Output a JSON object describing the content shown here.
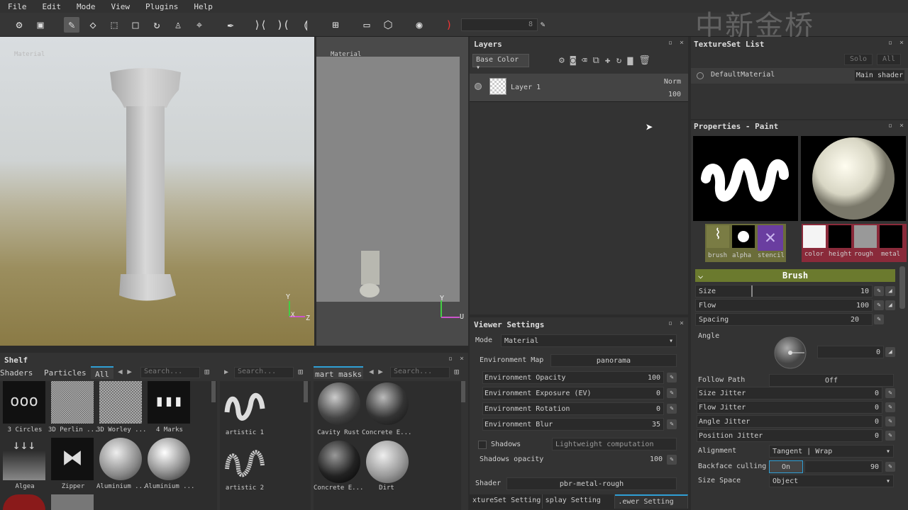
{
  "menu": [
    "File",
    "Edit",
    "Mode",
    "View",
    "Plugins",
    "Help"
  ],
  "toolbar": {
    "field_value": "8"
  },
  "watermark": "中新金桥",
  "viewport3d": {
    "label": "Material",
    "axis_y": "Y",
    "axis_x": "X",
    "axis_z": "Z"
  },
  "viewport2d": {
    "label": "Material",
    "axis_y": "Y",
    "axis_u": "U"
  },
  "layers": {
    "title": "Layers",
    "channel": "Base Color",
    "layer_name": "Layer 1",
    "blend": "Norm",
    "opacity": "100"
  },
  "viewer": {
    "title": "Viewer Settings",
    "mode_label": "Mode",
    "mode_value": "Material",
    "env_map_label": "Environment Map",
    "env_map_value": "panorama",
    "rows": [
      {
        "label": "Environment Opacity",
        "value": "100"
      },
      {
        "label": "Environment Exposure (EV)",
        "value": "0"
      },
      {
        "label": "Environment Rotation",
        "value": "0"
      },
      {
        "label": "Environment Blur",
        "value": "35"
      }
    ],
    "shadows_label": "Shadows",
    "shadows_value": "Lightweight computation",
    "shadows_opacity_label": "Shadows opacity",
    "shadows_opacity_value": "100",
    "shader_label": "Shader",
    "shader_value": "pbr-metal-rough"
  },
  "bottom_tabs": [
    "xtureSet Setting",
    "splay Setting",
    ".ewer Setting"
  ],
  "tsl": {
    "title": "TextureSet List",
    "solo": "Solo",
    "all": "All",
    "material": "DefaultMaterial",
    "shader": "Main shader"
  },
  "props": {
    "title": "Properties - Paint",
    "slots": [
      "brush",
      "alpha",
      "stencil"
    ],
    "maps": [
      "color",
      "height",
      "rough",
      "metal"
    ],
    "section": "Brush",
    "size_label": "Size",
    "size_value": "10",
    "flow_label": "Flow",
    "flow_value": "100",
    "spacing_label": "Spacing",
    "spacing_value": "20",
    "angle_label": "Angle",
    "angle_value": "0",
    "follow_label": "Follow Path",
    "follow_value": "Off",
    "jitters": [
      {
        "label": "Size Jitter",
        "value": "0"
      },
      {
        "label": "Flow Jitter",
        "value": "0"
      },
      {
        "label": "Angle Jitter",
        "value": "0"
      },
      {
        "label": "Position Jitter",
        "value": "0"
      }
    ],
    "alignment_label": "Alignment",
    "alignment_value": "Tangent | Wrap",
    "backface_label": "Backface culling",
    "backface_on": "On",
    "backface_value": "90",
    "sizespace_label": "Size Space",
    "sizespace_value": "Object"
  },
  "shelf": {
    "title": "Shelf",
    "tabs": [
      "Shaders",
      "Particles",
      "All"
    ],
    "search": "Search...",
    "search2": "Search...",
    "mid_tab": "mart masks",
    "search3": "Search...",
    "items": [
      "3 Circles",
      "3D Perlin ...",
      "3D Worley ...",
      "4 Marks",
      "Algea",
      "Zipper",
      "Aluminium ...",
      "Aluminium ..."
    ],
    "brushes": [
      "artistic 1",
      "artistic 2"
    ],
    "masks": [
      "Cavity Rust",
      "Concrete E...",
      "Concrete E...",
      "Dirt"
    ]
  }
}
